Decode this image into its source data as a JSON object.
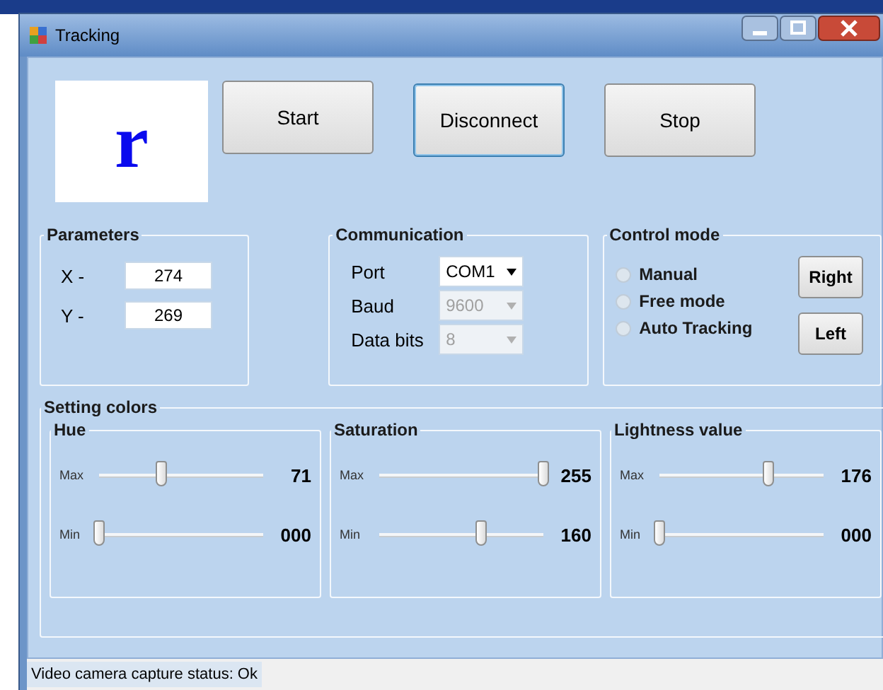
{
  "window": {
    "title": "Tracking"
  },
  "display": {
    "letter": "r"
  },
  "buttons": [
    {
      "label": "Start",
      "focused": false
    },
    {
      "label": "Disconnect",
      "focused": true
    },
    {
      "label": "Stop",
      "focused": false
    }
  ],
  "parameters": {
    "title": "Parameters",
    "fields": [
      {
        "label": "X -",
        "value": "274"
      },
      {
        "label": "Y -",
        "value": "269"
      }
    ]
  },
  "communication": {
    "title": "Communication",
    "fields": [
      {
        "label": "Port",
        "value": "COM1",
        "disabled": false
      },
      {
        "label": "Baud",
        "value": "9600",
        "disabled": true
      },
      {
        "label": "Data bits",
        "value": "8",
        "disabled": true
      }
    ]
  },
  "control_mode": {
    "title": "Control mode",
    "options": [
      {
        "label": "Manual",
        "selected": false
      },
      {
        "label": "Free mode",
        "selected": false
      },
      {
        "label": "Auto Tracking",
        "selected": false
      }
    ],
    "buttons": [
      "Right",
      "Left"
    ]
  },
  "setting_colors": {
    "title": "Setting colors",
    "groups": [
      {
        "title": "Hue",
        "sliders": [
          {
            "label": "Max",
            "level": 0.38,
            "reading": "71"
          },
          {
            "label": "Min",
            "level": 0,
            "reading": "000"
          }
        ]
      },
      {
        "title": "Saturation",
        "sliders": [
          {
            "label": "Max",
            "level": 1,
            "reading": "255"
          },
          {
            "label": "Min",
            "level": 0.62,
            "reading": "160"
          }
        ]
      },
      {
        "title": "Lightness value",
        "sliders": [
          {
            "label": "Max",
            "level": 0.66,
            "reading": "176"
          },
          {
            "label": "Min",
            "level": 0,
            "reading": "000"
          }
        ]
      }
    ]
  },
  "status_bar": {
    "text": "Video camera capture status: Ok"
  }
}
